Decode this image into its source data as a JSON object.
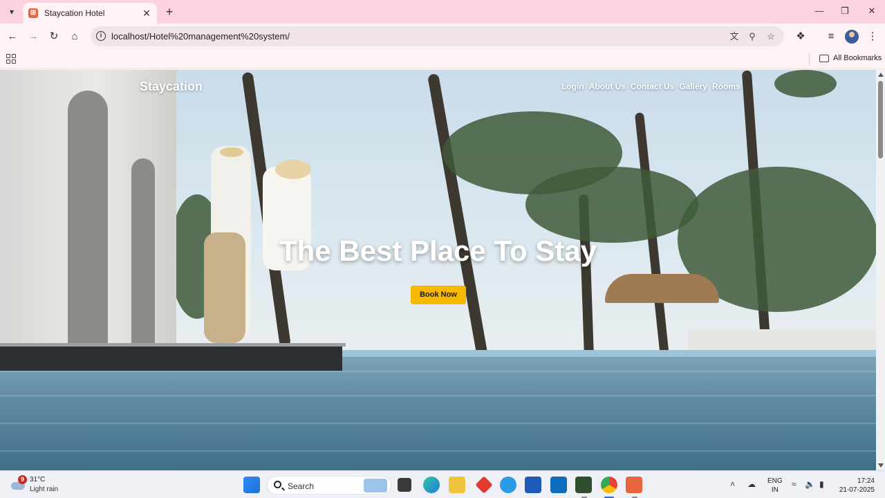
{
  "browser": {
    "tab_title": "Staycation Hotel",
    "url": "localhost/Hotel%20management%20system/",
    "bookmarks_label": "All Bookmarks"
  },
  "site": {
    "brand": "Staycation",
    "nav": [
      "Login",
      "About Us",
      "Contact Us",
      "Gallery",
      "Rooms"
    ],
    "hero_title": "The Best Place To Stay",
    "cta_label": "Book Now",
    "accent_color": "#f6b800"
  },
  "taskbar": {
    "weather_badge": "9",
    "temperature": "31°C",
    "weather_desc": "Light rain",
    "search_label": "Search",
    "lang_top": "ENG",
    "lang_bottom": "IN",
    "time": "17:24",
    "date": "21-07-2025"
  },
  "icons": {
    "tab_bar": [
      "tab-search-icon",
      "favicon",
      "close-icon",
      "new-tab-icon",
      "minimize-icon",
      "restore-icon",
      "close-window-icon"
    ],
    "toolbar": [
      "back-icon",
      "forward-icon",
      "reload-icon",
      "home-icon",
      "site-info-icon",
      "translate-icon",
      "zoom-icon",
      "star-icon",
      "extensions-icon",
      "media-icon",
      "profile-avatar",
      "menu-icon"
    ]
  }
}
